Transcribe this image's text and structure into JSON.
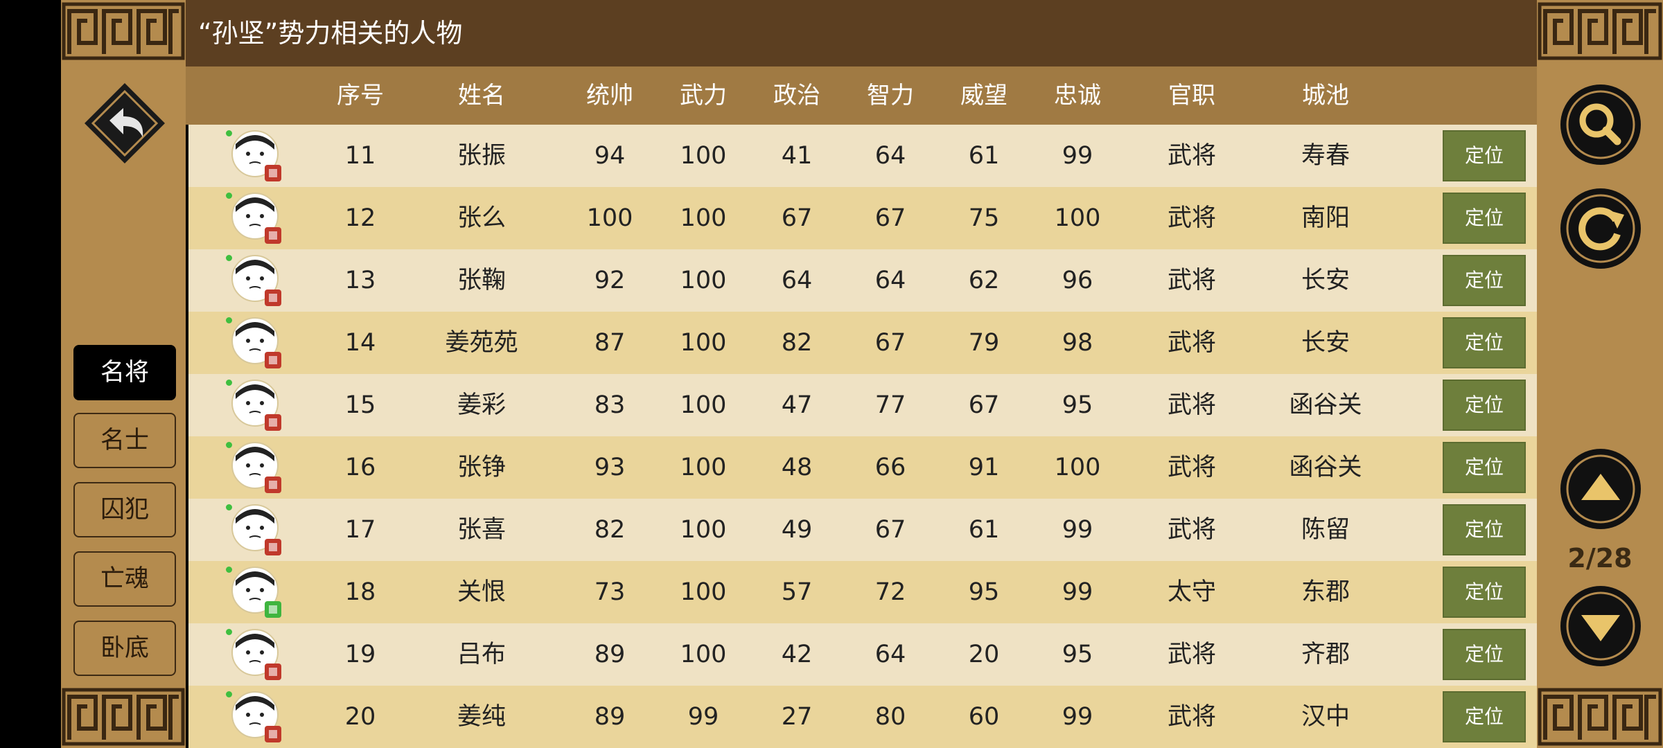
{
  "title": "“孙坚”势力相关的人物",
  "columns": [
    "序号",
    "姓名",
    "统帅",
    "武力",
    "政治",
    "智力",
    "威望",
    "忠诚",
    "官职",
    "城池"
  ],
  "tabs": [
    {
      "label": "名将",
      "active": true
    },
    {
      "label": "名士",
      "active": false
    },
    {
      "label": "囚犯",
      "active": false
    },
    {
      "label": "亡魂",
      "active": false
    },
    {
      "label": "卧底",
      "active": false
    }
  ],
  "rows": [
    {
      "id": "11",
      "name": "张振",
      "tongshuai": "94",
      "wuli": "100",
      "zhengzhi": "41",
      "zhili": "64",
      "weiwang": "61",
      "zhongcheng": "99",
      "guanzhi": "武将",
      "city": "寿春",
      "action": "定位",
      "portrait": "general-portrait-icon"
    },
    {
      "id": "12",
      "name": "张么",
      "tongshuai": "100",
      "wuli": "100",
      "zhengzhi": "67",
      "zhili": "67",
      "weiwang": "75",
      "zhongcheng": "100",
      "guanzhi": "武将",
      "city": "南阳",
      "action": "定位",
      "portrait": "general-portrait-icon"
    },
    {
      "id": "13",
      "name": "张鞠",
      "tongshuai": "92",
      "wuli": "100",
      "zhengzhi": "64",
      "zhili": "64",
      "weiwang": "62",
      "zhongcheng": "96",
      "guanzhi": "武将",
      "city": "长安",
      "action": "定位",
      "portrait": "general-portrait-icon"
    },
    {
      "id": "14",
      "name": "姜苑苑",
      "tongshuai": "87",
      "wuli": "100",
      "zhengzhi": "82",
      "zhili": "67",
      "weiwang": "79",
      "zhongcheng": "98",
      "guanzhi": "武将",
      "city": "长安",
      "action": "定位",
      "portrait": "general-portrait-icon"
    },
    {
      "id": "15",
      "name": "姜彩",
      "tongshuai": "83",
      "wuli": "100",
      "zhengzhi": "47",
      "zhili": "77",
      "weiwang": "67",
      "zhongcheng": "95",
      "guanzhi": "武将",
      "city": "函谷关",
      "action": "定位",
      "portrait": "general-portrait-icon"
    },
    {
      "id": "16",
      "name": "张铮",
      "tongshuai": "93",
      "wuli": "100",
      "zhengzhi": "48",
      "zhili": "66",
      "weiwang": "91",
      "zhongcheng": "100",
      "guanzhi": "武将",
      "city": "函谷关",
      "action": "定位",
      "portrait": "general-portrait-icon"
    },
    {
      "id": "17",
      "name": "张喜",
      "tongshuai": "82",
      "wuli": "100",
      "zhengzhi": "49",
      "zhili": "67",
      "weiwang": "61",
      "zhongcheng": "99",
      "guanzhi": "武将",
      "city": "陈留",
      "action": "定位",
      "portrait": "general-portrait-icon"
    },
    {
      "id": "18",
      "name": "关恨",
      "tongshuai": "73",
      "wuli": "100",
      "zhengzhi": "57",
      "zhili": "72",
      "weiwang": "95",
      "zhongcheng": "99",
      "guanzhi": "太守",
      "city": "东郡",
      "action": "定位",
      "portrait": "governor-portrait-icon"
    },
    {
      "id": "19",
      "name": "吕布",
      "tongshuai": "89",
      "wuli": "100",
      "zhengzhi": "42",
      "zhili": "64",
      "weiwang": "20",
      "zhongcheng": "95",
      "guanzhi": "武将",
      "city": "齐郡",
      "action": "定位",
      "portrait": "general-portrait-icon"
    },
    {
      "id": "20",
      "name": "姜纯",
      "tongshuai": "89",
      "wuli": "99",
      "zhengzhi": "27",
      "zhili": "80",
      "weiwang": "60",
      "zhongcheng": "99",
      "guanzhi": "武将",
      "city": "汉中",
      "action": "定位",
      "portrait": "general-portrait-icon"
    }
  ],
  "pagination": {
    "text": "2/28"
  },
  "icons": {
    "back": "back-arrow-icon",
    "search": "search-icon",
    "refresh": "refresh-icon",
    "up": "page-up-icon",
    "down": "page-down-icon"
  },
  "colors": {
    "frame": "#b48b4e",
    "titlebar": "#5c3f21",
    "header": "#a07a43",
    "row_light": "#efe2c4",
    "row_dark": "#ead59b",
    "locate_button": "#6e7f3c",
    "accent_gold": "#e9c46a"
  }
}
